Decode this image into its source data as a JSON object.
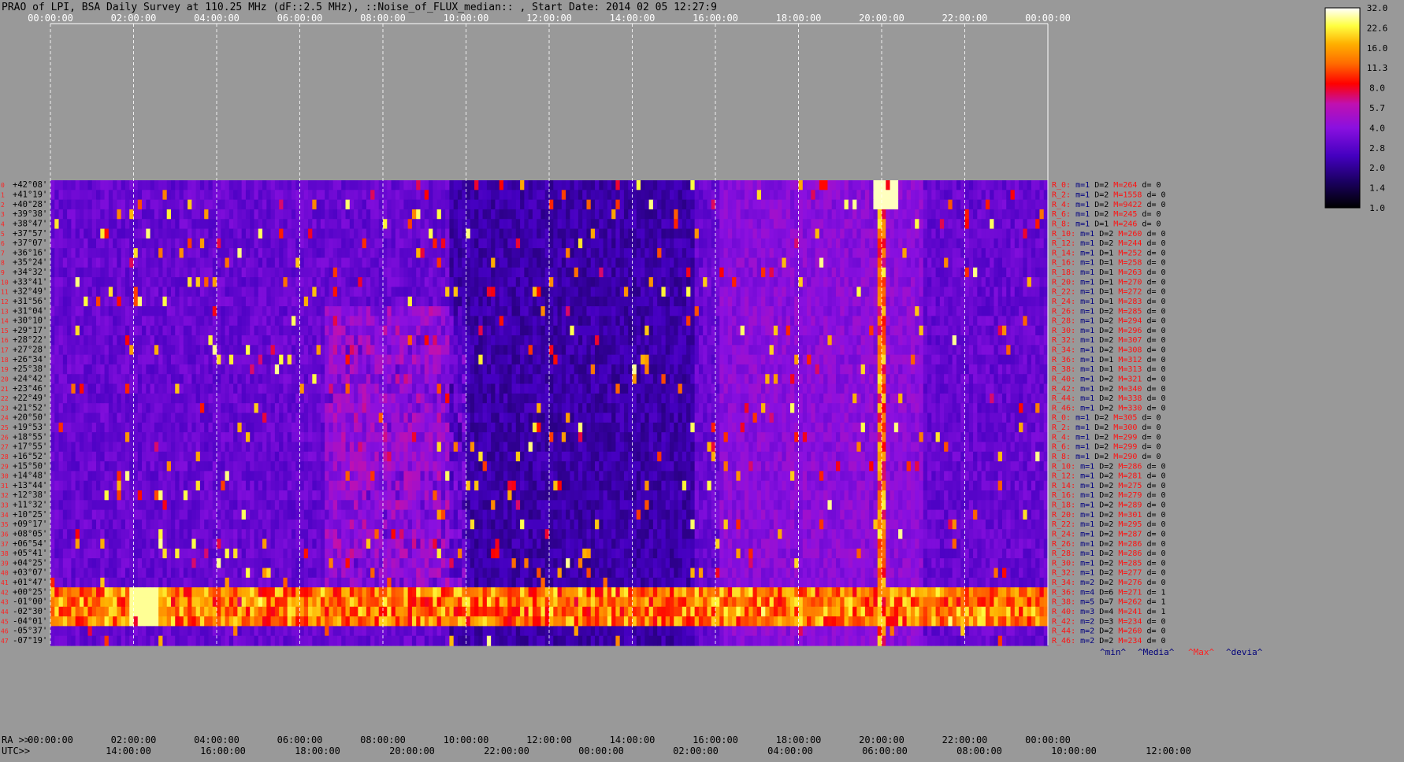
{
  "chart_data": {
    "type": "heatmap",
    "title": "PRAO of LPI, BSA Daily Survey at 110.25 MHz (dF::2.5 MHz), ::Noise_of_FLUX_median:: , Start Date: 2014 02 05 12:27:9",
    "top_ticks": [
      "00:00:00",
      "02:00:00",
      "04:00:00",
      "06:00:00",
      "08:00:00",
      "10:00:00",
      "12:00:00",
      "14:00:00",
      "16:00:00",
      "18:00:00",
      "20:00:00",
      "22:00:00",
      "00:00:00"
    ],
    "ra_prefix": "RA >>",
    "ra_ticks": [
      "00:00:00",
      "02:00:00",
      "04:00:00",
      "06:00:00",
      "08:00:00",
      "10:00:00",
      "12:00:00",
      "14:00:00",
      "16:00:00",
      "18:00:00",
      "20:00:00",
      "22:00:00",
      "00:00:00"
    ],
    "utc_prefix": "UTC>>",
    "utc_ticks": [
      "14:00:00",
      "16:00:00",
      "18:00:00",
      "20:00:00",
      "22:00:00",
      "00:00:00",
      "02:00:00",
      "04:00:00",
      "06:00:00",
      "08:00:00",
      "10:00:00",
      "12:00:00"
    ],
    "declinations": [
      "+42°08'",
      "+41°19'",
      "+40°28'",
      "+39°38'",
      "+38°47'",
      "+37°57'",
      "+37°07'",
      "+36°16'",
      "+35°24'",
      "+34°32'",
      "+33°41'",
      "+32°49'",
      "+31°56'",
      "+31°04'",
      "+30°10'",
      "+29°17'",
      "+28°22'",
      "+27°28'",
      "+26°34'",
      "+25°38'",
      "+24°42'",
      "+23°46'",
      "+22°49'",
      "+21°52'",
      "+20°50'",
      "+19°53'",
      "+18°55'",
      "+17°55'",
      "+16°52'",
      "+15°50'",
      "+14°48'",
      "+13°44'",
      "+12°38'",
      "+11°32'",
      "+10°25'",
      "+09°17'",
      "+08°05'",
      "+06°54'",
      "+05°41'",
      "+04°25'",
      "+03°07'",
      "+01°47'",
      "+00°25'",
      "-01°00'",
      "-02°30'",
      "-04°01'",
      "-05°37'",
      "-07°19'"
    ],
    "beam_numbers": [
      "0",
      "1",
      "2",
      "3",
      "4",
      "5",
      "6",
      "7",
      "8",
      "9",
      "10",
      "11",
      "12",
      "13",
      "14",
      "15",
      "16",
      "17",
      "18",
      "19",
      "20",
      "21",
      "22",
      "23",
      "24",
      "25",
      "26",
      "27",
      "28",
      "29",
      "30",
      "31",
      "32",
      "33",
      "34",
      "35",
      "36",
      "37",
      "38",
      "39",
      "40",
      "41",
      "42",
      "43",
      "44",
      "45",
      "46",
      "47"
    ],
    "colorbar": {
      "ticks": [
        "32.0",
        "22.6",
        "16.0",
        "11.3",
        "8.0",
        "5.7",
        "4.0",
        "2.8",
        "2.0",
        "1.4",
        "1.0"
      ],
      "min": 1.0,
      "max": 32.0,
      "scale": "log"
    },
    "channel_stats": [
      {
        "r": "R_0:",
        "m": "m=1",
        "d": "D=2",
        "mx": "M=264",
        "dev": "d= 0"
      },
      {
        "r": "R_2:",
        "m": "m=1",
        "d": "D=2",
        "mx": "M=1558",
        "dev": "d= 0"
      },
      {
        "r": "R_4:",
        "m": "m=1",
        "d": "D=2",
        "mx": "M=9422",
        "dev": "d= 0"
      },
      {
        "r": "R_6:",
        "m": "m=1",
        "d": "D=2",
        "mx": "M=245",
        "dev": "d= 0"
      },
      {
        "r": "R_8:",
        "m": "m=1",
        "d": "D=1",
        "mx": "M=246",
        "dev": "d= 0"
      },
      {
        "r": "R_10:",
        "m": "m=1",
        "d": "D=2",
        "mx": "M=260",
        "dev": "d= 0"
      },
      {
        "r": "R_12:",
        "m": "m=1",
        "d": "D=2",
        "mx": "M=244",
        "dev": "d= 0"
      },
      {
        "r": "R_14:",
        "m": "m=1",
        "d": "D=1",
        "mx": "M=252",
        "dev": "d= 0"
      },
      {
        "r": "R_16:",
        "m": "m=1",
        "d": "D=1",
        "mx": "M=258",
        "dev": "d= 0"
      },
      {
        "r": "R_18:",
        "m": "m=1",
        "d": "D=1",
        "mx": "M=263",
        "dev": "d= 0"
      },
      {
        "r": "R_20:",
        "m": "m=1",
        "d": "D=1",
        "mx": "M=270",
        "dev": "d= 0"
      },
      {
        "r": "R_22:",
        "m": "m=1",
        "d": "D=1",
        "mx": "M=272",
        "dev": "d= 0"
      },
      {
        "r": "R_24:",
        "m": "m=1",
        "d": "D=1",
        "mx": "M=283",
        "dev": "d= 0"
      },
      {
        "r": "R_26:",
        "m": "m=1",
        "d": "D=2",
        "mx": "M=285",
        "dev": "d= 0"
      },
      {
        "r": "R_28:",
        "m": "m=1",
        "d": "D=2",
        "mx": "M=294",
        "dev": "d= 0"
      },
      {
        "r": "R_30:",
        "m": "m=1",
        "d": "D=2",
        "mx": "M=296",
        "dev": "d= 0"
      },
      {
        "r": "R_32:",
        "m": "m=1",
        "d": "D=2",
        "mx": "M=307",
        "dev": "d= 0"
      },
      {
        "r": "R_34:",
        "m": "m=1",
        "d": "D=2",
        "mx": "M=308",
        "dev": "d= 0"
      },
      {
        "r": "R_36:",
        "m": "m=1",
        "d": "D=1",
        "mx": "M=312",
        "dev": "d= 0"
      },
      {
        "r": "R_38:",
        "m": "m=1",
        "d": "D=1",
        "mx": "M=313",
        "dev": "d= 0"
      },
      {
        "r": "R_40:",
        "m": "m=1",
        "d": "D=2",
        "mx": "M=321",
        "dev": "d= 0"
      },
      {
        "r": "R_42:",
        "m": "m=1",
        "d": "D=2",
        "mx": "M=340",
        "dev": "d= 0"
      },
      {
        "r": "R_44:",
        "m": "m=1",
        "d": "D=2",
        "mx": "M=338",
        "dev": "d= 0"
      },
      {
        "r": "R_46:",
        "m": "m=1",
        "d": "D=2",
        "mx": "M=330",
        "dev": "d= 0"
      },
      {
        "r": "R_0:",
        "m": "m=1",
        "d": "D=2",
        "mx": "M=305",
        "dev": "d= 0"
      },
      {
        "r": "R_2:",
        "m": "m=1",
        "d": "D=2",
        "mx": "M=300",
        "dev": "d= 0"
      },
      {
        "r": "R_4:",
        "m": "m=1",
        "d": "D=2",
        "mx": "M=299",
        "dev": "d= 0"
      },
      {
        "r": "R_6:",
        "m": "m=1",
        "d": "D=2",
        "mx": "M=299",
        "dev": "d= 0"
      },
      {
        "r": "R_8:",
        "m": "m=1",
        "d": "D=2",
        "mx": "M=290",
        "dev": "d= 0"
      },
      {
        "r": "R_10:",
        "m": "m=1",
        "d": "D=2",
        "mx": "M=286",
        "dev": "d= 0"
      },
      {
        "r": "R_12:",
        "m": "m=1",
        "d": "D=2",
        "mx": "M=281",
        "dev": "d= 0"
      },
      {
        "r": "R_14:",
        "m": "m=1",
        "d": "D=2",
        "mx": "M=275",
        "dev": "d= 0"
      },
      {
        "r": "R_16:",
        "m": "m=1",
        "d": "D=2",
        "mx": "M=279",
        "dev": "d= 0"
      },
      {
        "r": "R_18:",
        "m": "m=1",
        "d": "D=2",
        "mx": "M=289",
        "dev": "d= 0"
      },
      {
        "r": "R_20:",
        "m": "m=1",
        "d": "D=2",
        "mx": "M=301",
        "dev": "d= 0"
      },
      {
        "r": "R_22:",
        "m": "m=1",
        "d": "D=2",
        "mx": "M=295",
        "dev": "d= 0"
      },
      {
        "r": "R_24:",
        "m": "m=1",
        "d": "D=2",
        "mx": "M=287",
        "dev": "d= 0"
      },
      {
        "r": "R_26:",
        "m": "m=1",
        "d": "D=2",
        "mx": "M=286",
        "dev": "d= 0"
      },
      {
        "r": "R_28:",
        "m": "m=1",
        "d": "D=2",
        "mx": "M=286",
        "dev": "d= 0"
      },
      {
        "r": "R_30:",
        "m": "m=1",
        "d": "D=2",
        "mx": "M=285",
        "dev": "d= 0"
      },
      {
        "r": "R_32:",
        "m": "m=1",
        "d": "D=2",
        "mx": "M=277",
        "dev": "d= 0"
      },
      {
        "r": "R_34:",
        "m": "m=2",
        "d": "D=2",
        "mx": "M=276",
        "dev": "d= 0"
      },
      {
        "r": "R_36:",
        "m": "m=4",
        "d": "D=6",
        "mx": "M=271",
        "dev": "d= 1"
      },
      {
        "r": "R_38:",
        "m": "m=5",
        "d": "D=7",
        "mx": "M=262",
        "dev": "d= 1"
      },
      {
        "r": "R_40:",
        "m": "m=3",
        "d": "D=4",
        "mx": "M=241",
        "dev": "d= 1"
      },
      {
        "r": "R_42:",
        "m": "m=2",
        "d": "D=3",
        "mx": "M=234",
        "dev": "d= 0"
      },
      {
        "r": "R_44:",
        "m": "m=2",
        "d": "D=2",
        "mx": "M=260",
        "dev": "d= 0"
      },
      {
        "r": "R_46:",
        "m": "m=2",
        "d": "D=2",
        "mx": "M=234",
        "dev": "d= 0"
      }
    ],
    "stat_legend": [
      {
        "label": "^min^",
        "color": "#00007a"
      },
      {
        "label": "^Media^",
        "color": "#00007a"
      },
      {
        "label": "^Max^",
        "color": "#ff2020"
      },
      {
        "label": "^devia^",
        "color": "#00007a"
      }
    ]
  },
  "colors": {
    "background": "#999999",
    "text": "#000000",
    "beam_number": "#ff2020",
    "stat_red": "#ff1010",
    "stat_blue": "#000080"
  }
}
